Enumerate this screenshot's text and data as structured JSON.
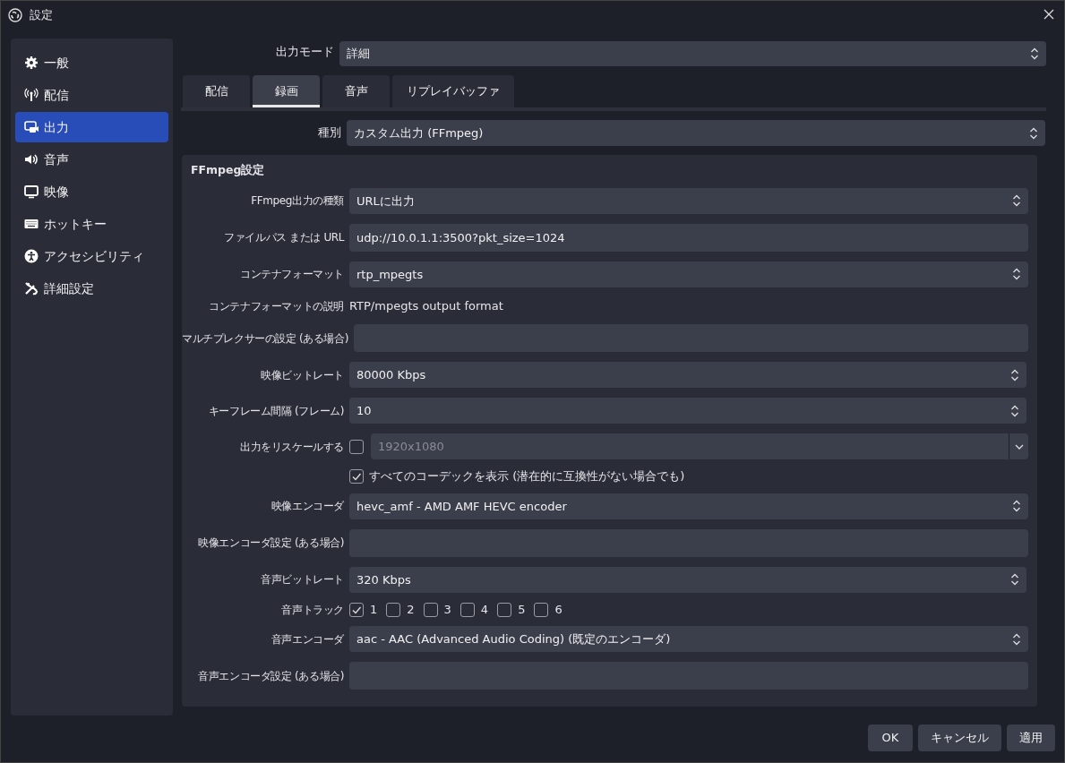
{
  "window": {
    "title": "設定"
  },
  "sidebar": {
    "items": [
      {
        "label": "一般",
        "selected": false
      },
      {
        "label": "配信",
        "selected": false
      },
      {
        "label": "出力",
        "selected": true
      },
      {
        "label": "音声",
        "selected": false
      },
      {
        "label": "映像",
        "selected": false
      },
      {
        "label": "ホットキー",
        "selected": false
      },
      {
        "label": "アクセシビリティ",
        "selected": false
      },
      {
        "label": "詳細設定",
        "selected": false
      }
    ]
  },
  "output_mode": {
    "label": "出力モード",
    "value": "詳細"
  },
  "tabs": [
    {
      "label": "配信",
      "selected": false
    },
    {
      "label": "録画",
      "selected": true
    },
    {
      "label": "音声",
      "selected": false
    },
    {
      "label": "リプレイバッファ",
      "selected": false
    }
  ],
  "type": {
    "label": "種別",
    "value": "カスタム出力 (FFmpeg)"
  },
  "group": {
    "title": "FFmpeg設定",
    "rows": [
      {
        "kind": "select",
        "label": "FFmpeg出力の種類",
        "value": "URLに出力"
      },
      {
        "kind": "text",
        "label": "ファイルパス または URL",
        "value": "udp://10.0.1.1:3500?pkt_size=1024"
      },
      {
        "kind": "select",
        "label": "コンテナフォーマット",
        "value": "rtp_mpegts"
      },
      {
        "kind": "info",
        "label": "コンテナフォーマットの説明",
        "value": "RTP/mpegts output format"
      },
      {
        "kind": "text",
        "label": "マルチプレクサーの設定 (ある場合)"
      },
      {
        "kind": "spin",
        "label": "映像ビットレート",
        "value": "80000 Kbps"
      },
      {
        "kind": "spin",
        "label": "キーフレーム間隔 (フレーム)",
        "value": "10"
      },
      {
        "kind": "rescale",
        "label": "出力をリスケールする",
        "checked": false,
        "value": "1920x1080",
        "disabled": true
      },
      {
        "kind": "checkbox",
        "label": "すべてのコーデックを表示 (潜在的に互換性がない場合でも)",
        "checked": true
      },
      {
        "kind": "select",
        "label": "映像エンコーダ",
        "value": "hevc_amf - AMD AMF HEVC encoder"
      },
      {
        "kind": "text",
        "label": "映像エンコーダ設定 (ある場合)"
      },
      {
        "kind": "spin",
        "label": "音声ビットレート",
        "value": "320 Kbps"
      },
      {
        "kind": "tracks",
        "label": "音声トラック",
        "tracks": [
          {
            "label": "1",
            "checked": true
          },
          {
            "label": "2",
            "checked": false
          },
          {
            "label": "3",
            "checked": false
          },
          {
            "label": "4",
            "checked": false
          },
          {
            "label": "5",
            "checked": false
          },
          {
            "label": "6",
            "checked": false
          }
        ]
      },
      {
        "kind": "select",
        "label": "音声エンコーダ",
        "value": "aac - AAC (Advanced Audio Coding) (既定のエンコーダ)"
      },
      {
        "kind": "text",
        "label": "音声エンコーダ設定 (ある場合)"
      }
    ]
  },
  "buttons": [
    "OK",
    "キャンセル",
    "適用"
  ]
}
